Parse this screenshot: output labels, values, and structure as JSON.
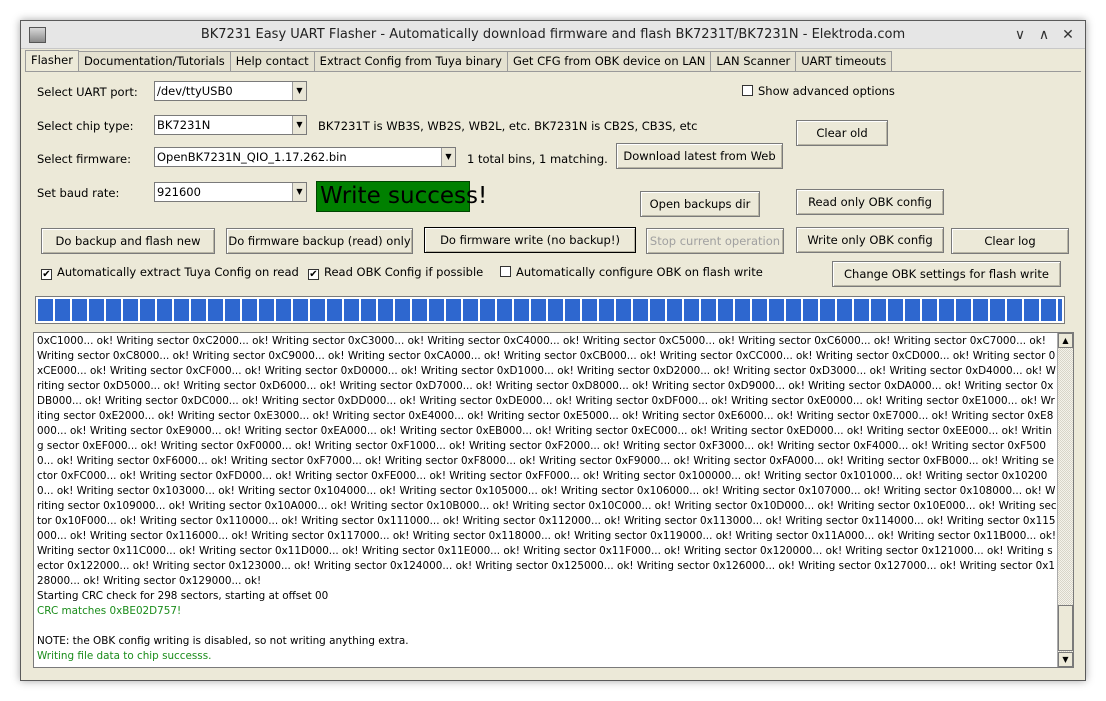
{
  "window": {
    "title": "BK7231 Easy UART Flasher - Automatically download firmware and flash BK7231T/BK7231N - Elektroda.com",
    "minimize": "∨",
    "maximize": "∧",
    "close": "✕"
  },
  "tabs": [
    "Flasher",
    "Documentation/Tutorials",
    "Help contact",
    "Extract Config from Tuya binary",
    "Get CFG from OBK device on LAN",
    "LAN Scanner",
    "UART timeouts"
  ],
  "form": {
    "uart_label": "Select UART port:",
    "uart_value": "/dev/ttyUSB0",
    "chip_label": "Select chip type:",
    "chip_value": "BK7231N",
    "chip_hint": "BK7231T is WB3S, WB2S, WB2L, etc. BK7231N is CB2S, CB3S, etc",
    "firmware_label": "Select firmware:",
    "firmware_value": "OpenBK7231N_QIO_1.17.262.bin",
    "firmware_hint": "1 total bins, 1 matching.",
    "baud_label": "Set baud rate:",
    "baud_value": "921600",
    "status": "Write success!",
    "show_advanced": "Show advanced options"
  },
  "buttons": {
    "clear_old": "Clear old",
    "download_latest": "Download latest from Web",
    "open_backups": "Open backups dir",
    "read_obk": "Read only OBK config",
    "backup_flash": "Do backup and flash new",
    "firmware_backup": "Do firmware backup (read) only",
    "firmware_write": "Do firmware write (no backup!)",
    "stop": "Stop current operation",
    "write_obk": "Write only OBK config",
    "clear_log": "Clear log",
    "change_obk": "Change OBK settings for flash write"
  },
  "checks": {
    "auto_extract": "Automatically extract Tuya Config on read",
    "read_obk_config": "Read OBK Config if possible",
    "auto_configure": "Automatically configure OBK on flash write"
  },
  "progress": {
    "percent": 100
  },
  "log": {
    "lines": [
      {
        "text": "0xC1000... ok! Writing sector 0xC2000... ok! Writing sector 0xC3000... ok! Writing sector 0xC4000... ok! Writing sector 0xC5000... ok! Writing sector 0xC6000... ok! Writing sector 0xC7000... ok! Writing sector 0xC8000... ok! Writing sector 0xC9000... ok! Writing sector 0xCA000... ok! Writing sector 0xCB000... ok! Writing sector 0xCC000... ok! Writing sector 0xCD000... ok! Writing sector 0xCE000... ok! Writing sector 0xCF000... ok! Writing sector 0xD0000... ok! Writing sector 0xD1000... ok! Writing sector 0xD2000... ok! Writing sector 0xD3000... ok! Writing sector 0xD4000... ok! Writing sector 0xD5000... ok! Writing sector 0xD6000... ok! Writing sector 0xD7000... ok! Writing sector 0xD8000... ok! Writing sector 0xD9000... ok! Writing sector 0xDA000... ok! Writing sector 0xDB000... ok! Writing sector 0xDC000... ok! Writing sector 0xDD000... ok! Writing sector 0xDE000... ok! Writing sector 0xDF000... ok! Writing sector 0xE0000... ok! Writing sector 0xE1000... ok! Writing sector 0xE2000... ok! Writing sector 0xE3000... ok! Writing sector 0xE4000... ok! Writing sector 0xE5000... ok! Writing sector 0xE6000... ok! Writing sector 0xE7000... ok! Writing sector 0xE8000... ok! Writing sector 0xE9000... ok! Writing sector 0xEA000... ok! Writing sector 0xEB000... ok! Writing sector 0xEC000... ok! Writing sector 0xED000... ok! Writing sector 0xEE000... ok! Writing sector 0xEF000... ok! Writing sector 0xF0000... ok! Writing sector 0xF1000... ok! Writing sector 0xF2000... ok! Writing sector 0xF3000... ok! Writing sector 0xF4000... ok! Writing sector 0xF5000... ok! Writing sector 0xF6000... ok! Writing sector 0xF7000... ok! Writing sector 0xF8000... ok! Writing sector 0xF9000... ok! Writing sector 0xFA000... ok! Writing sector 0xFB000... ok! Writing sector 0xFC000... ok! Writing sector 0xFD000... ok! Writing sector 0xFE000... ok! Writing sector 0xFF000... ok! Writing sector 0x100000... ok! Writing sector 0x101000... ok! Writing sector 0x102000... ok! Writing sector 0x103000... ok! Writing sector 0x104000... ok! Writing sector 0x105000... ok! Writing sector 0x106000... ok! Writing sector 0x107000... ok! Writing sector 0x108000... ok! Writing sector 0x109000... ok! Writing sector 0x10A000... ok! Writing sector 0x10B000... ok! Writing sector 0x10C000... ok! Writing sector 0x10D000... ok! Writing sector 0x10E000... ok! Writing sector 0x10F000... ok! Writing sector 0x110000... ok! Writing sector 0x111000... ok! Writing sector 0x112000... ok! Writing sector 0x113000... ok! Writing sector 0x114000... ok! Writing sector 0x115000... ok! Writing sector 0x116000... ok! Writing sector 0x117000... ok! Writing sector 0x118000... ok! Writing sector 0x119000... ok! Writing sector 0x11A000... ok! Writing sector 0x11B000... ok! Writing sector 0x11C000... ok! Writing sector 0x11D000... ok! Writing sector 0x11E000... ok! Writing sector 0x11F000... ok! Writing sector 0x120000... ok! Writing sector 0x121000... ok! Writing sector 0x122000... ok! Writing sector 0x123000... ok! Writing sector 0x124000... ok! Writing sector 0x125000... ok! Writing sector 0x126000... ok! Writing sector 0x127000... ok! Writing sector 0x128000... ok! Writing sector 0x129000... ok!",
        "color": "black"
      },
      {
        "text": "Starting CRC check for 298 sectors, starting at offset 00",
        "color": "black"
      },
      {
        "text": "CRC matches 0xBE02D757!",
        "color": "green"
      },
      {
        "text": "",
        "color": "black"
      },
      {
        "text": "NOTE: the OBK config writing is disabled, so not writing anything extra.",
        "color": "black"
      },
      {
        "text": "Writing file data to chip successs.",
        "color": "green"
      }
    ]
  },
  "colors": {
    "success_bg": "#008000",
    "progress_block": "#2e67cf",
    "log_green": "#1a8c1a"
  }
}
